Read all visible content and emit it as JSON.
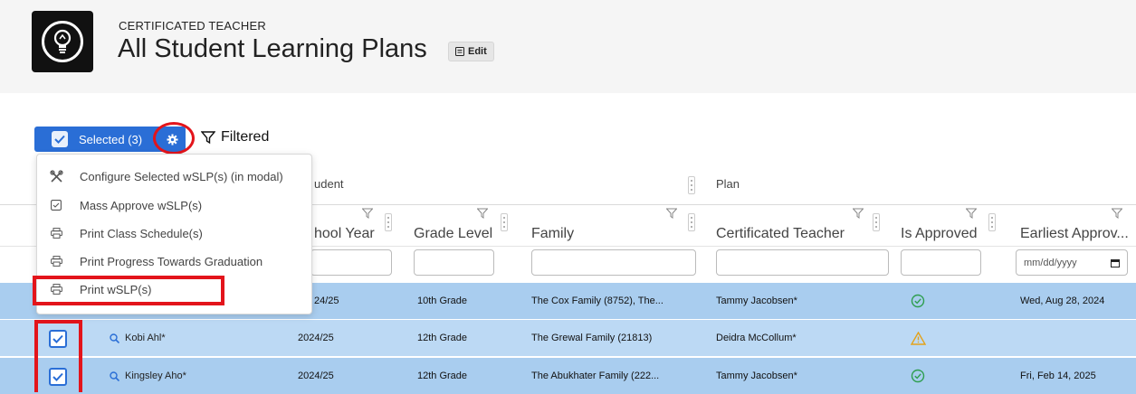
{
  "header": {
    "subtitle": "CERTIFICATED TEACHER",
    "title": "All Student Learning Plans",
    "edit_label": "Edit",
    "logo_icon": "lightbulb-icon"
  },
  "toolbar": {
    "selected_label": "Selected (3)",
    "filtered_label": "Filtered",
    "accent": "#2a6ed6",
    "annotation_color": "#e3141b"
  },
  "menu": {
    "items": [
      {
        "label": "Configure Selected wSLP(s) (in modal)",
        "icon": "tools-icon"
      },
      {
        "label": "Mass Approve wSLP(s)",
        "icon": "checkbox-icon"
      },
      {
        "label": "Print Class Schedule(s)",
        "icon": "printer-icon"
      },
      {
        "label": "Print Progress Towards Graduation",
        "icon": "printer-icon"
      },
      {
        "label": "Print wSLP(s)",
        "icon": "printer-icon"
      }
    ]
  },
  "table": {
    "groups": {
      "student": "udent",
      "plan": "Plan"
    },
    "columns": {
      "school_year": "hool Year",
      "grade_level": "Grade Level",
      "family": "Family",
      "teacher": "Certificated Teacher",
      "approved": "Is Approved",
      "earliest": "Earliest Approv..."
    },
    "date_placeholder": "mm/dd/yyyy",
    "rows": [
      {
        "student": "",
        "year": "24/25",
        "grade": "10th Grade",
        "family": "The Cox Family (8752), The...",
        "teacher": "Tammy Jacobsen*",
        "status": "approved",
        "date": "Wed, Aug 28, 2024"
      },
      {
        "student": "Kobi Ahl*",
        "year": "2024/25",
        "grade": "12th Grade",
        "family": "The Grewal Family (21813)",
        "teacher": "Deidra McCollum*",
        "status": "warning",
        "date": ""
      },
      {
        "student": "Kingsley Aho*",
        "year": "2024/25",
        "grade": "12th Grade",
        "family": "The Abukhater Family (222...",
        "teacher": "Tammy Jacobsen*",
        "status": "approved",
        "date": "Fri, Feb 14, 2025"
      }
    ]
  }
}
